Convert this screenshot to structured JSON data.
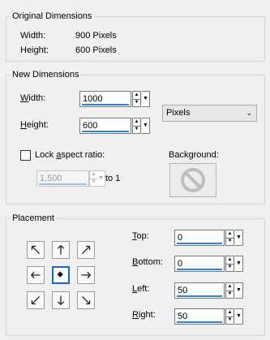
{
  "original": {
    "title": "Original Dimensions",
    "width_label": "Width:",
    "width_value": "900 Pixels",
    "height_label": "Height:",
    "height_value": "600 Pixels"
  },
  "new_dims": {
    "title": "New Dimensions",
    "width_label_first": "W",
    "width_label_rest": "idth:",
    "width_value": "1000",
    "height_label_first": "H",
    "height_label_rest": "eight:",
    "height_value": "600",
    "units": "Pixels",
    "lock_label_pre": "Lock ",
    "lock_label_u": "a",
    "lock_label_post": "spect ratio:",
    "ratio_value": "1,500",
    "ratio_to": "to 1",
    "background_label": "Background:"
  },
  "placement": {
    "title": "Placement",
    "top_label_first": "T",
    "top_label_rest": "op:",
    "top_value": "0",
    "bottom_label_first": "B",
    "bottom_label_rest": "ottom:",
    "bottom_value": "0",
    "left_label_first": "L",
    "left_label_rest": "eft:",
    "left_value": "50",
    "right_label_first": "R",
    "right_label_rest": "ight:",
    "right_value": "50",
    "grid": [
      {
        "name": "align-top-left-icon"
      },
      {
        "name": "align-top-center-icon"
      },
      {
        "name": "align-top-right-icon"
      },
      {
        "name": "align-middle-left-icon"
      },
      {
        "name": "align-center-icon"
      },
      {
        "name": "align-middle-right-icon"
      },
      {
        "name": "align-bottom-left-icon"
      },
      {
        "name": "align-bottom-center-icon"
      },
      {
        "name": "align-bottom-right-icon"
      }
    ],
    "selected_index": 4
  },
  "colors": {
    "accent": "#2f84d6",
    "selected_border": "#1668b8"
  }
}
